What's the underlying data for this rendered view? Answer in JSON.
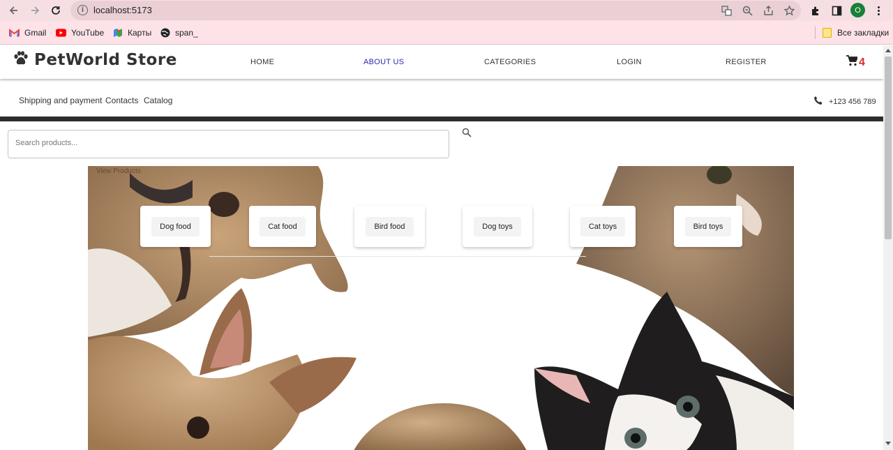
{
  "browser": {
    "url": "localhost:5173",
    "profile_initial": "O",
    "bookmarks": [
      {
        "label": "Gmail",
        "icon": "gmail-icon"
      },
      {
        "label": "YouTube",
        "icon": "youtube-icon"
      },
      {
        "label": "Карты",
        "icon": "maps-icon"
      },
      {
        "label": "span_",
        "icon": "globe-icon"
      }
    ],
    "all_bookmarks": "Все закладки"
  },
  "header": {
    "logo": "PetWorld Store",
    "nav": [
      "HOME",
      "ABOUT US",
      "CATEGORIES",
      "LOGIN",
      "REGISTER"
    ],
    "active_nav": "ABOUT US",
    "cart_count": "4"
  },
  "subbar": {
    "links": [
      "Shipping and payment",
      "Contacts",
      "Catalog"
    ],
    "phone": "+123 456 789"
  },
  "search": {
    "placeholder": "Search products..."
  },
  "hero": {
    "view_products": "View Products",
    "categories": [
      "Dog food",
      "Cat food",
      "Bird food",
      "Dog toys",
      "Cat toys",
      "Bird toys"
    ]
  },
  "colors": {
    "accent_nav": "#2a2aa8",
    "cart_badge": "#d32f2f",
    "divider": "#2c2c2c"
  }
}
